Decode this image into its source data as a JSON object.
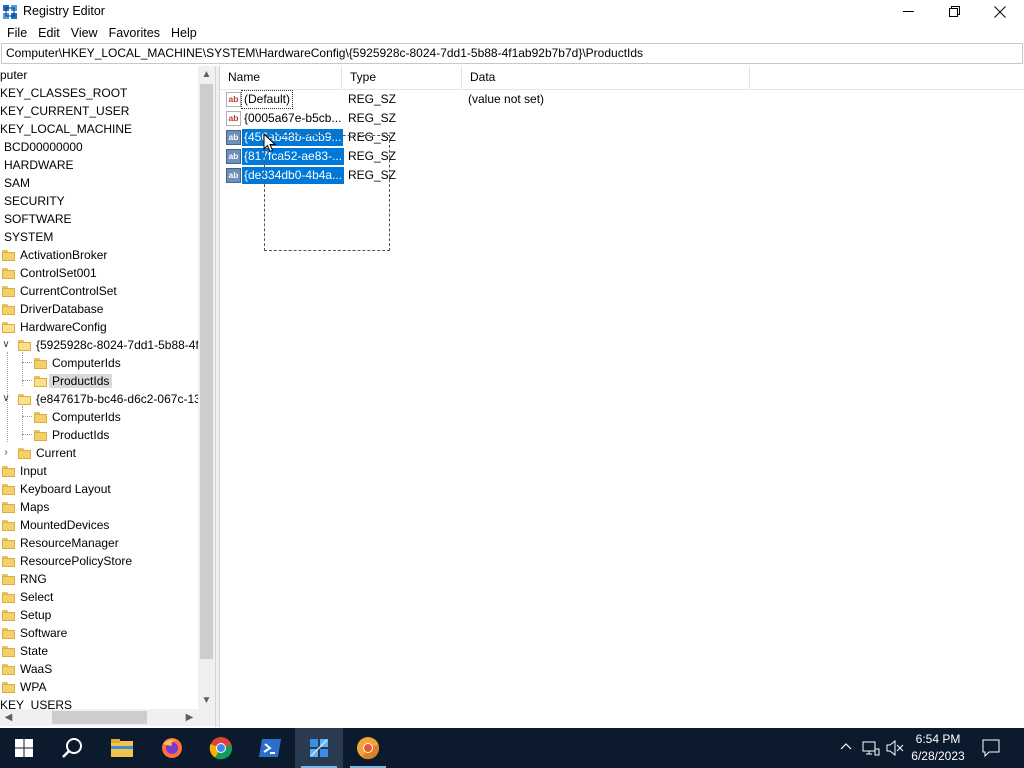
{
  "window": {
    "title": "Registry Editor"
  },
  "menu": {
    "items": [
      "File",
      "Edit",
      "View",
      "Favorites",
      "Help"
    ]
  },
  "address": {
    "path": "Computer\\HKEY_LOCAL_MACHINE\\SYSTEM\\HardwareConfig\\{5925928c-8024-7dd1-5b88-4f1ab92b7b7d}\\ProductIds"
  },
  "tree": {
    "items": [
      {
        "label": "puter"
      },
      {
        "label": "KEY_CLASSES_ROOT"
      },
      {
        "label": "KEY_CURRENT_USER"
      },
      {
        "label": "KEY_LOCAL_MACHINE"
      },
      {
        "label": "BCD00000000"
      },
      {
        "label": "HARDWARE"
      },
      {
        "label": "SAM"
      },
      {
        "label": "SECURITY"
      },
      {
        "label": "SOFTWARE"
      },
      {
        "label": "SYSTEM"
      },
      {
        "label": "ActivationBroker"
      },
      {
        "label": "ControlSet001"
      },
      {
        "label": "CurrentControlSet"
      },
      {
        "label": "DriverDatabase"
      },
      {
        "label": "HardwareConfig"
      },
      {
        "label": "{5925928c-8024-7dd1-5b88-4f1"
      },
      {
        "label": "ComputerIds"
      },
      {
        "label": "ProductIds"
      },
      {
        "label": "{e847617b-bc46-d6c2-067c-13"
      },
      {
        "label": "ComputerIds"
      },
      {
        "label": "ProductIds"
      },
      {
        "label": "Current"
      },
      {
        "label": "Input"
      },
      {
        "label": "Keyboard Layout"
      },
      {
        "label": "Maps"
      },
      {
        "label": "MountedDevices"
      },
      {
        "label": "ResourceManager"
      },
      {
        "label": "ResourcePolicyStore"
      },
      {
        "label": "RNG"
      },
      {
        "label": "Select"
      },
      {
        "label": "Setup"
      },
      {
        "label": "Software"
      },
      {
        "label": "State"
      },
      {
        "label": "WaaS"
      },
      {
        "label": "WPA"
      },
      {
        "label": "KEY_USERS"
      }
    ]
  },
  "list": {
    "columns": [
      "Name",
      "Type",
      "Data"
    ],
    "rows": [
      {
        "name": "(Default)",
        "type": "REG_SZ",
        "data": "(value not set)"
      },
      {
        "name": "{0005a67e-b5cb...",
        "type": "REG_SZ",
        "data": ""
      },
      {
        "name": "{456ab48b-acb9...",
        "type": "REG_SZ",
        "data": ""
      },
      {
        "name": "{817fca52-ae83-...",
        "type": "REG_SZ",
        "data": ""
      },
      {
        "name": "{de334db0-4b4a...",
        "type": "REG_SZ",
        "data": ""
      }
    ],
    "icon_text": "ab"
  },
  "taskbar": {
    "apps": [
      "start-icon",
      "search-icon",
      "file-explorer-icon",
      "firefox-icon",
      "chrome-icon",
      "powershell-icon",
      "regedit-icon",
      "chrome-canary-icon"
    ],
    "time": "6:54 PM",
    "date": "6/28/2023"
  }
}
